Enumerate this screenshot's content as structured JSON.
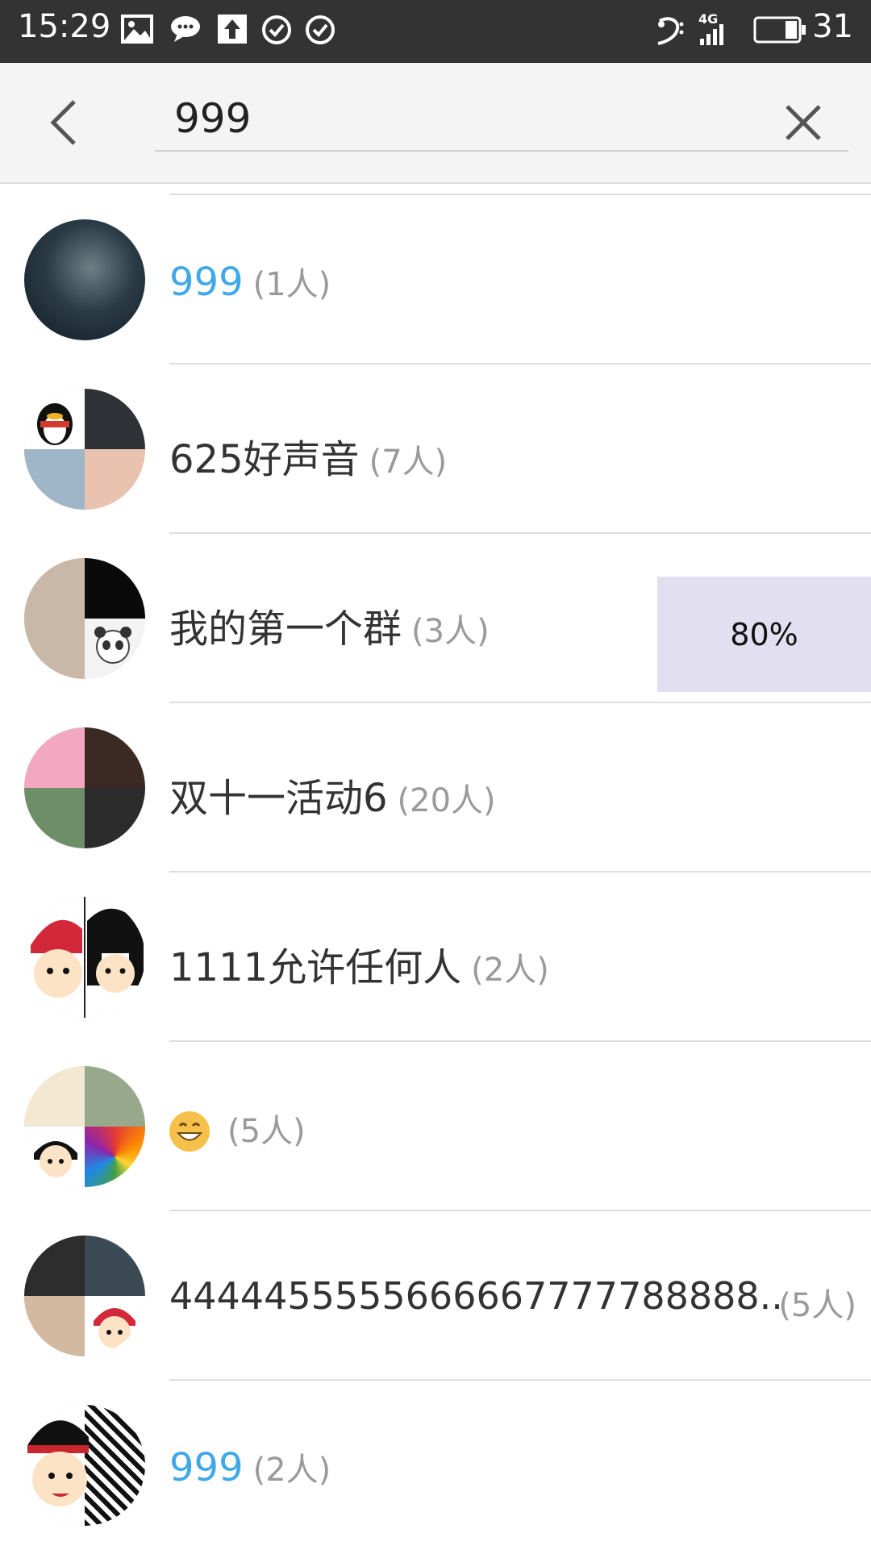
{
  "status_bar": {
    "time": "15:29",
    "network": "4G",
    "battery": "31",
    "icons": [
      "image-icon",
      "chat-icon",
      "upload-icon",
      "check-circle-icon",
      "check-circle-icon",
      "music-clef-icon",
      "signal-icon",
      "battery-icon"
    ]
  },
  "search": {
    "query": "999",
    "icons": [
      "back-arrow-icon",
      "clear-x-icon"
    ]
  },
  "results": [
    {
      "name": "999",
      "count": "(1人)",
      "highlight": true
    },
    {
      "name": "625好声音",
      "count": "(7人)",
      "highlight": false
    },
    {
      "name": "我的第一个群",
      "count": "(3人)",
      "highlight": false
    },
    {
      "name": "双十一活动6",
      "count": "(20人)",
      "highlight": false
    },
    {
      "name": "1111允许任何人",
      "count": "(2人)",
      "highlight": false
    },
    {
      "name": "",
      "count": "(5人)",
      "highlight": false,
      "emoji": "grinning-face-icon"
    },
    {
      "name": "4444455555666667777788888..",
      "count": "(5人)",
      "highlight": false
    },
    {
      "name": "999",
      "count": "(2人)",
      "highlight": true
    }
  ],
  "overlay": {
    "label": "80%"
  },
  "colors": {
    "status_bar": "#333333",
    "header_bg": "#f4f4f4",
    "highlight": "#3fa9e8",
    "count_text": "#9a9a9a",
    "overlay_bg": "#e2e0f0"
  }
}
